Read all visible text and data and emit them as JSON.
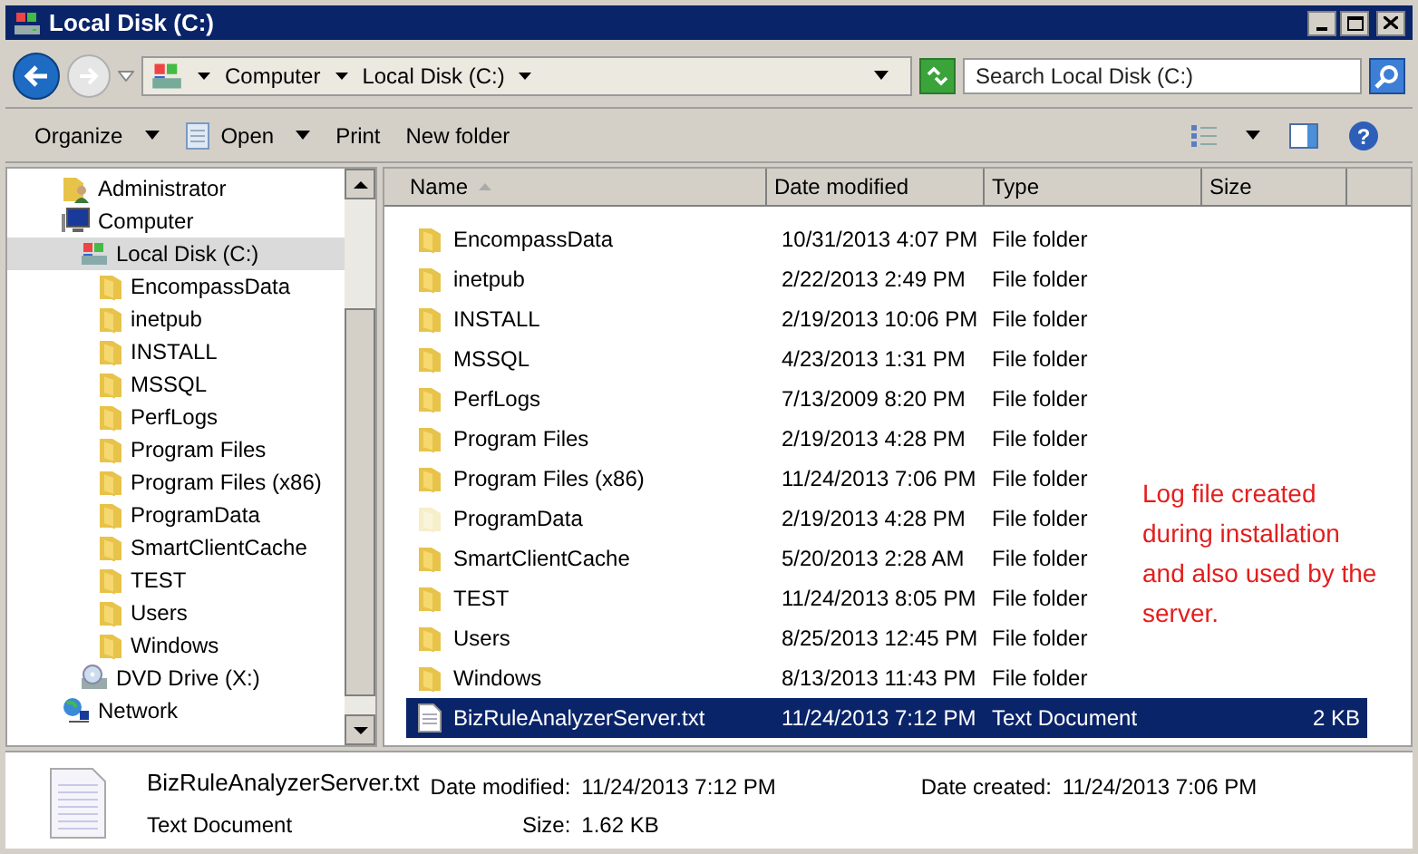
{
  "window": {
    "title": "Local Disk (C:)"
  },
  "address_bar": {
    "breadcrumbs": [
      "Computer",
      "Local Disk (C:)"
    ],
    "search_placeholder": "Search Local Disk (C:)"
  },
  "toolbar": {
    "help_button": "?",
    "buttons": [
      {
        "label": "Organize",
        "dropdown": true
      },
      {
        "label": "Open",
        "dropdown": true,
        "icon": true
      },
      {
        "label": "Print",
        "dropdown": false
      },
      {
        "label": "New folder",
        "dropdown": false
      }
    ]
  },
  "navigation": [
    {
      "label": "Administrator",
      "kind": "user",
      "selected": false
    },
    {
      "label": "Computer",
      "kind": "computer",
      "selected": false,
      "children": [
        {
          "label": "Local Disk (C:)",
          "kind": "drive",
          "selected": true,
          "children": [
            {
              "label": "EncompassData",
              "kind": "folder",
              "selected": false
            },
            {
              "label": "inetpub",
              "kind": "folder",
              "selected": false
            },
            {
              "label": "INSTALL",
              "kind": "folder",
              "selected": false
            },
            {
              "label": "MSSQL",
              "kind": "folder",
              "selected": false
            },
            {
              "label": "PerfLogs",
              "kind": "folder",
              "selected": false
            },
            {
              "label": "Program Files",
              "kind": "folder",
              "selected": false
            },
            {
              "label": "Program Files (x86)",
              "kind": "folder",
              "selected": false
            },
            {
              "label": "ProgramData",
              "kind": "folder",
              "selected": false
            },
            {
              "label": "SmartClientCache",
              "kind": "folder",
              "selected": false
            },
            {
              "label": "TEST",
              "kind": "folder",
              "selected": false
            },
            {
              "label": "Users",
              "kind": "folder",
              "selected": false
            },
            {
              "label": "Windows",
              "kind": "folder",
              "selected": false
            }
          ]
        },
        {
          "label": "DVD Drive (X:)",
          "kind": "dvd",
          "selected": false
        }
      ]
    },
    {
      "label": "Network",
      "kind": "network",
      "selected": false
    }
  ],
  "file_list": {
    "columns": [
      "Name",
      "Date modified",
      "Type",
      "Size"
    ],
    "rows": [
      {
        "name": "EncompassData",
        "date": "10/31/2013 4:07 PM",
        "type": "File folder",
        "kind": "folder",
        "hidden": false,
        "selected": false
      },
      {
        "name": "inetpub",
        "date": "2/22/2013 2:49 PM",
        "type": "File folder",
        "kind": "folder",
        "hidden": false,
        "selected": false
      },
      {
        "name": "INSTALL",
        "date": "2/19/2013 10:06 PM",
        "type": "File folder",
        "kind": "folder",
        "hidden": false,
        "selected": false
      },
      {
        "name": "MSSQL",
        "date": "4/23/2013 1:31 PM",
        "type": "File folder",
        "kind": "folder",
        "hidden": false,
        "selected": false
      },
      {
        "name": "PerfLogs",
        "date": "7/13/2009 8:20 PM",
        "type": "File folder",
        "kind": "folder",
        "hidden": false,
        "selected": false
      },
      {
        "name": "Program Files",
        "date": "2/19/2013 4:28 PM",
        "type": "File folder",
        "kind": "folder",
        "hidden": false,
        "selected": false
      },
      {
        "name": "Program Files (x86)",
        "date": "11/24/2013 7:06 PM",
        "type": "File folder",
        "kind": "folder",
        "hidden": false,
        "selected": false
      },
      {
        "name": "ProgramData",
        "date": "2/19/2013 4:28 PM",
        "type": "File folder",
        "kind": "folder",
        "hidden": true,
        "selected": false
      },
      {
        "name": "SmartClientCache",
        "date": "5/20/2013 2:28 AM",
        "type": "File folder",
        "kind": "folder",
        "hidden": false,
        "selected": false
      },
      {
        "name": "TEST",
        "date": "11/24/2013 8:05 PM",
        "type": "File folder",
        "kind": "folder",
        "hidden": false,
        "selected": false
      },
      {
        "name": "Users",
        "date": "8/25/2013 12:45 PM",
        "type": "File folder",
        "kind": "folder",
        "hidden": false,
        "selected": false
      },
      {
        "name": "Windows",
        "date": "8/13/2013 11:43 PM",
        "type": "File folder",
        "kind": "folder",
        "hidden": false,
        "selected": false
      },
      {
        "name": "BizRuleAnalyzerServer.txt",
        "date": "11/24/2013 7:12 PM",
        "type": "Text Document",
        "size": "2 KB",
        "kind": "text",
        "hidden": false,
        "selected": true
      }
    ]
  },
  "annotation": "Log file created during installation and also used by the server.",
  "details_pane": {
    "name": "BizRuleAnalyzerServer.txt",
    "type": "Text Document",
    "fields": [
      {
        "label": "Date modified:",
        "value": "11/24/2013 7:12 PM"
      },
      {
        "label": "Date created:",
        "value": "11/24/2013 7:06 PM"
      },
      {
        "label": "Size:",
        "value": "1.62 KB"
      }
    ]
  }
}
